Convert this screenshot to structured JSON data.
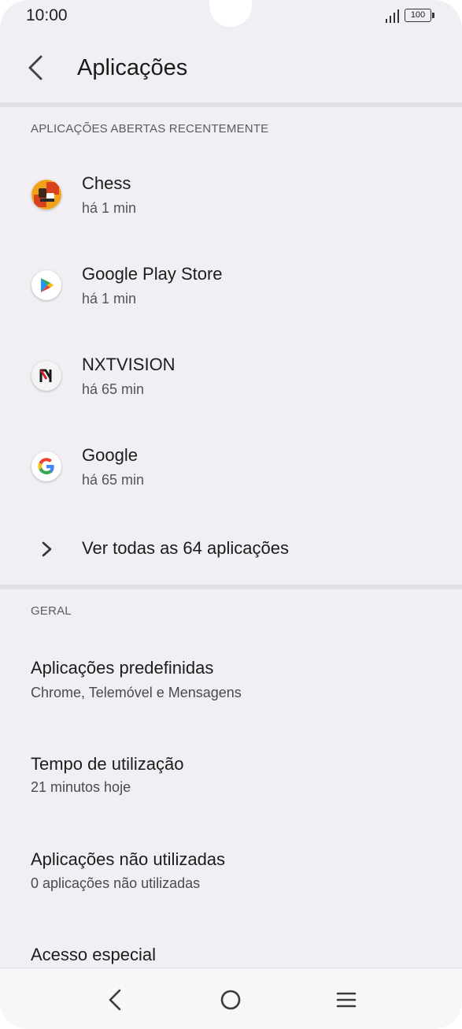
{
  "status_bar": {
    "time": "10:00",
    "battery": "100"
  },
  "app_bar": {
    "title": "Aplicações"
  },
  "recent": {
    "header": "APLICAÇÕES ABERTAS RECENTEMENTE",
    "apps": [
      {
        "name": "Chess",
        "time": "há 1 min",
        "icon": "chess-icon"
      },
      {
        "name": "Google Play Store",
        "time": "há 1 min",
        "icon": "play-store-icon"
      },
      {
        "name": "NXTVISION",
        "time": "há 65 min",
        "icon": "nxtvision-icon"
      },
      {
        "name": "Google",
        "time": "há 65 min",
        "icon": "google-icon"
      }
    ],
    "see_all": "Ver todas as 64 aplicações"
  },
  "general": {
    "header": "GERAL",
    "items": [
      {
        "title": "Aplicações predefinidas",
        "subtitle": "Chrome, Telemóvel e Mensagens"
      },
      {
        "title": "Tempo de utilização",
        "subtitle": "21 minutos hoje"
      },
      {
        "title": "Aplicações não utilizadas",
        "subtitle": "0 aplicações não utilizadas"
      },
      {
        "title": "Acesso especial"
      }
    ]
  },
  "nav_bar": {
    "buttons": [
      "back-icon",
      "home-icon",
      "recents-icon"
    ]
  }
}
